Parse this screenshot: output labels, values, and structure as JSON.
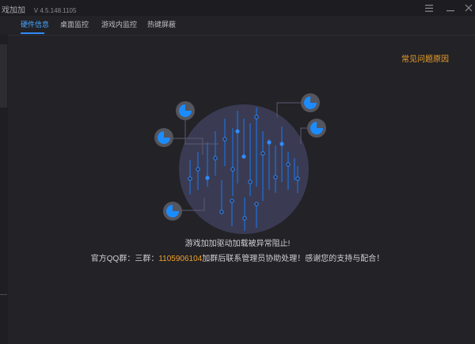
{
  "window": {
    "title": "戏加加",
    "version": "V 4.5.148.1105",
    "menu_icon": "menu-icon",
    "minimize_icon": "minimize-icon",
    "close_icon": "close-icon"
  },
  "tabs": [
    {
      "label": "硬件信息",
      "active": true
    },
    {
      "label": "桌面监控",
      "active": false
    },
    {
      "label": "游戏内监控",
      "active": false
    },
    {
      "label": "热键屏蔽",
      "active": false
    }
  ],
  "faq_link": "常见问题原因",
  "message": {
    "line1": "游戏加加驱动加载被异常阻止!",
    "line2_prefix": "官方QQ群：三群：",
    "qq_number": "1105906104",
    "line2_suffix": "加群后联系管理员协助处理！感谢您的支持与配合！"
  },
  "colors": {
    "accent": "#2f8bff",
    "warning": "#f0a12a",
    "background": "#222227"
  }
}
